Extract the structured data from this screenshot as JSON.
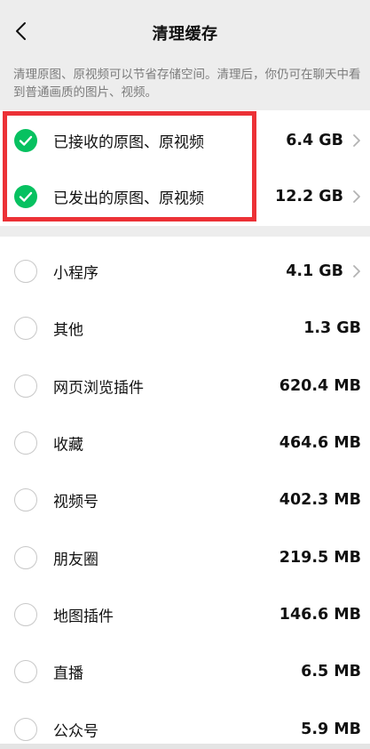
{
  "header": {
    "title": "清理缓存",
    "back_icon": "chevron-left-icon"
  },
  "description": "清理原图、原视频可以节省存储空间。清理后，你仍可在聊天中看到普通画质的图片、视频。",
  "colors": {
    "accent_green": "#07c160",
    "highlight_red": "#ec3136",
    "background": "#ededed"
  },
  "media_items": [
    {
      "label": "已接收的原图、原视频",
      "size": "6.4 GB",
      "checked": true,
      "has_chevron": true
    },
    {
      "label": "已发出的原图、原视频",
      "size": "12.2 GB",
      "checked": true,
      "has_chevron": true
    }
  ],
  "other_items": [
    {
      "label": "小程序",
      "size": "4.1 GB",
      "checked": false,
      "has_chevron": true
    },
    {
      "label": "其他",
      "size": "1.3 GB",
      "checked": false,
      "has_chevron": false
    },
    {
      "label": "网页浏览插件",
      "size": "620.4 MB",
      "checked": false,
      "has_chevron": false
    },
    {
      "label": "收藏",
      "size": "464.6 MB",
      "checked": false,
      "has_chevron": false
    },
    {
      "label": "视频号",
      "size": "402.3 MB",
      "checked": false,
      "has_chevron": false
    },
    {
      "label": "朋友圈",
      "size": "219.5 MB",
      "checked": false,
      "has_chevron": false
    },
    {
      "label": "地图插件",
      "size": "146.6 MB",
      "checked": false,
      "has_chevron": false
    },
    {
      "label": "直播",
      "size": "6.5 MB",
      "checked": false,
      "has_chevron": false
    },
    {
      "label": "公众号",
      "size": "5.9 MB",
      "checked": false,
      "has_chevron": false
    }
  ]
}
